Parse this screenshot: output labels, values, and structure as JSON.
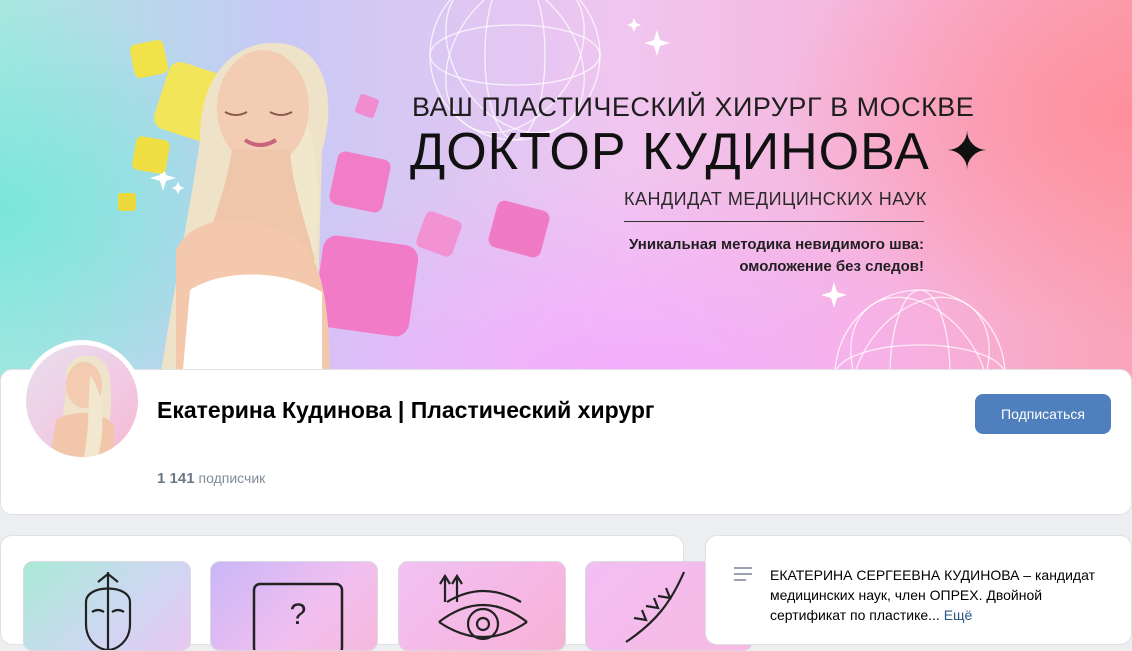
{
  "cover": {
    "line1": "ВАШ ПЛАСТИЧЕСКИЙ ХИРУРГ В МОСКВЕ",
    "line2": "ДОКТОР КУДИНОВА",
    "line3": "КАНДИДАТ МЕДИЦИНСКИХ НАУК",
    "line4a": "Уникальная методика невидимого шва:",
    "line4b": "омоложение без следов!"
  },
  "profile": {
    "name": "Екатерина Кудинова | Пластический хирург",
    "subscriber_count": "1 141",
    "subscriber_label": "подписчик",
    "subscribe_button": "Подписаться"
  },
  "tiles": [
    {
      "icon": "face-mask-icon"
    },
    {
      "icon": "question-box-icon"
    },
    {
      "icon": "eye-lift-icon"
    },
    {
      "icon": "body-contour-icon"
    }
  ],
  "about": {
    "text": "ЕКАТЕРИНА СЕРГЕЕВНА КУДИНОВА – кандидат медицинских наук, член ОПРЕХ. Двойной сертификат по пластике...",
    "more": "Ещё"
  },
  "colors": {
    "accent": "#4f7fbd",
    "link": "#2a5885",
    "background": "#edeef0"
  }
}
